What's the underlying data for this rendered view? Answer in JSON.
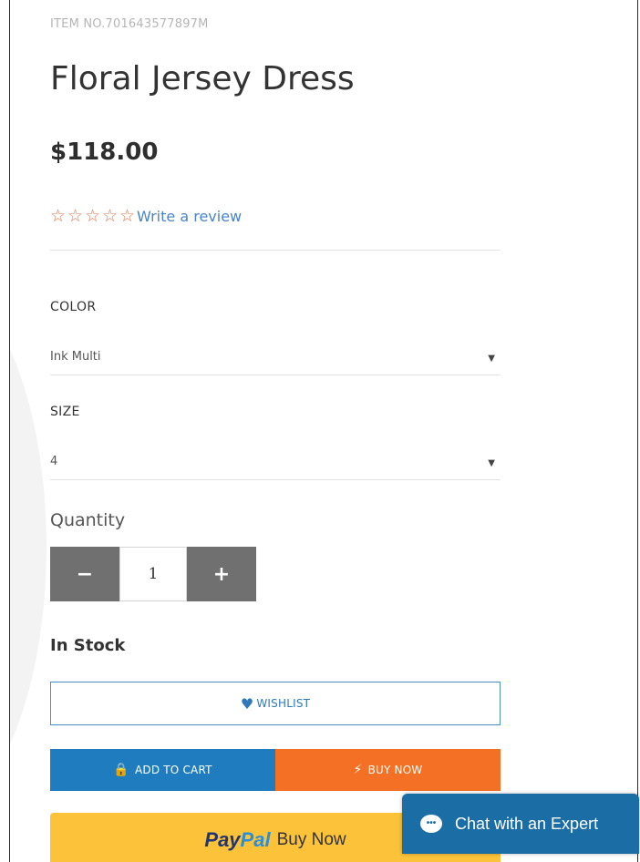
{
  "product": {
    "item_no": "ITEM NO.701643577897M",
    "title": "Floral Jersey Dress",
    "price": "$118.00"
  },
  "rating": {
    "stars": [
      "☆",
      "☆",
      "☆",
      "☆",
      "☆"
    ],
    "review_link": "Write a review"
  },
  "options": {
    "color_label": "COLOR",
    "color_value": "Ink Multi",
    "size_label": "SIZE",
    "size_value": "4",
    "caret": "▼"
  },
  "quantity": {
    "label": "Quantity",
    "minus": "−",
    "plus": "+",
    "value": "1"
  },
  "stock": "In Stock",
  "buttons": {
    "wishlist": "WISHLIST",
    "wishlist_icon": "♥",
    "add_to_cart": "ADD TO CART",
    "cart_icon": "🔒",
    "buy_now": "BUY NOW",
    "buy_icon": "⚡",
    "paypal_part1": "Pay",
    "paypal_part2": "Pal",
    "paypal_part3": "Buy Now"
  },
  "chat": {
    "label": "Chat with an Expert",
    "icon": "•••"
  },
  "colors": {
    "accent_blue": "#1f7dbf",
    "buy_orange": "#f37024",
    "paypal_yellow": "#fcc33a",
    "chat_blue": "#1a6ea5",
    "star": "#e07a55",
    "link": "#4a83c8"
  }
}
